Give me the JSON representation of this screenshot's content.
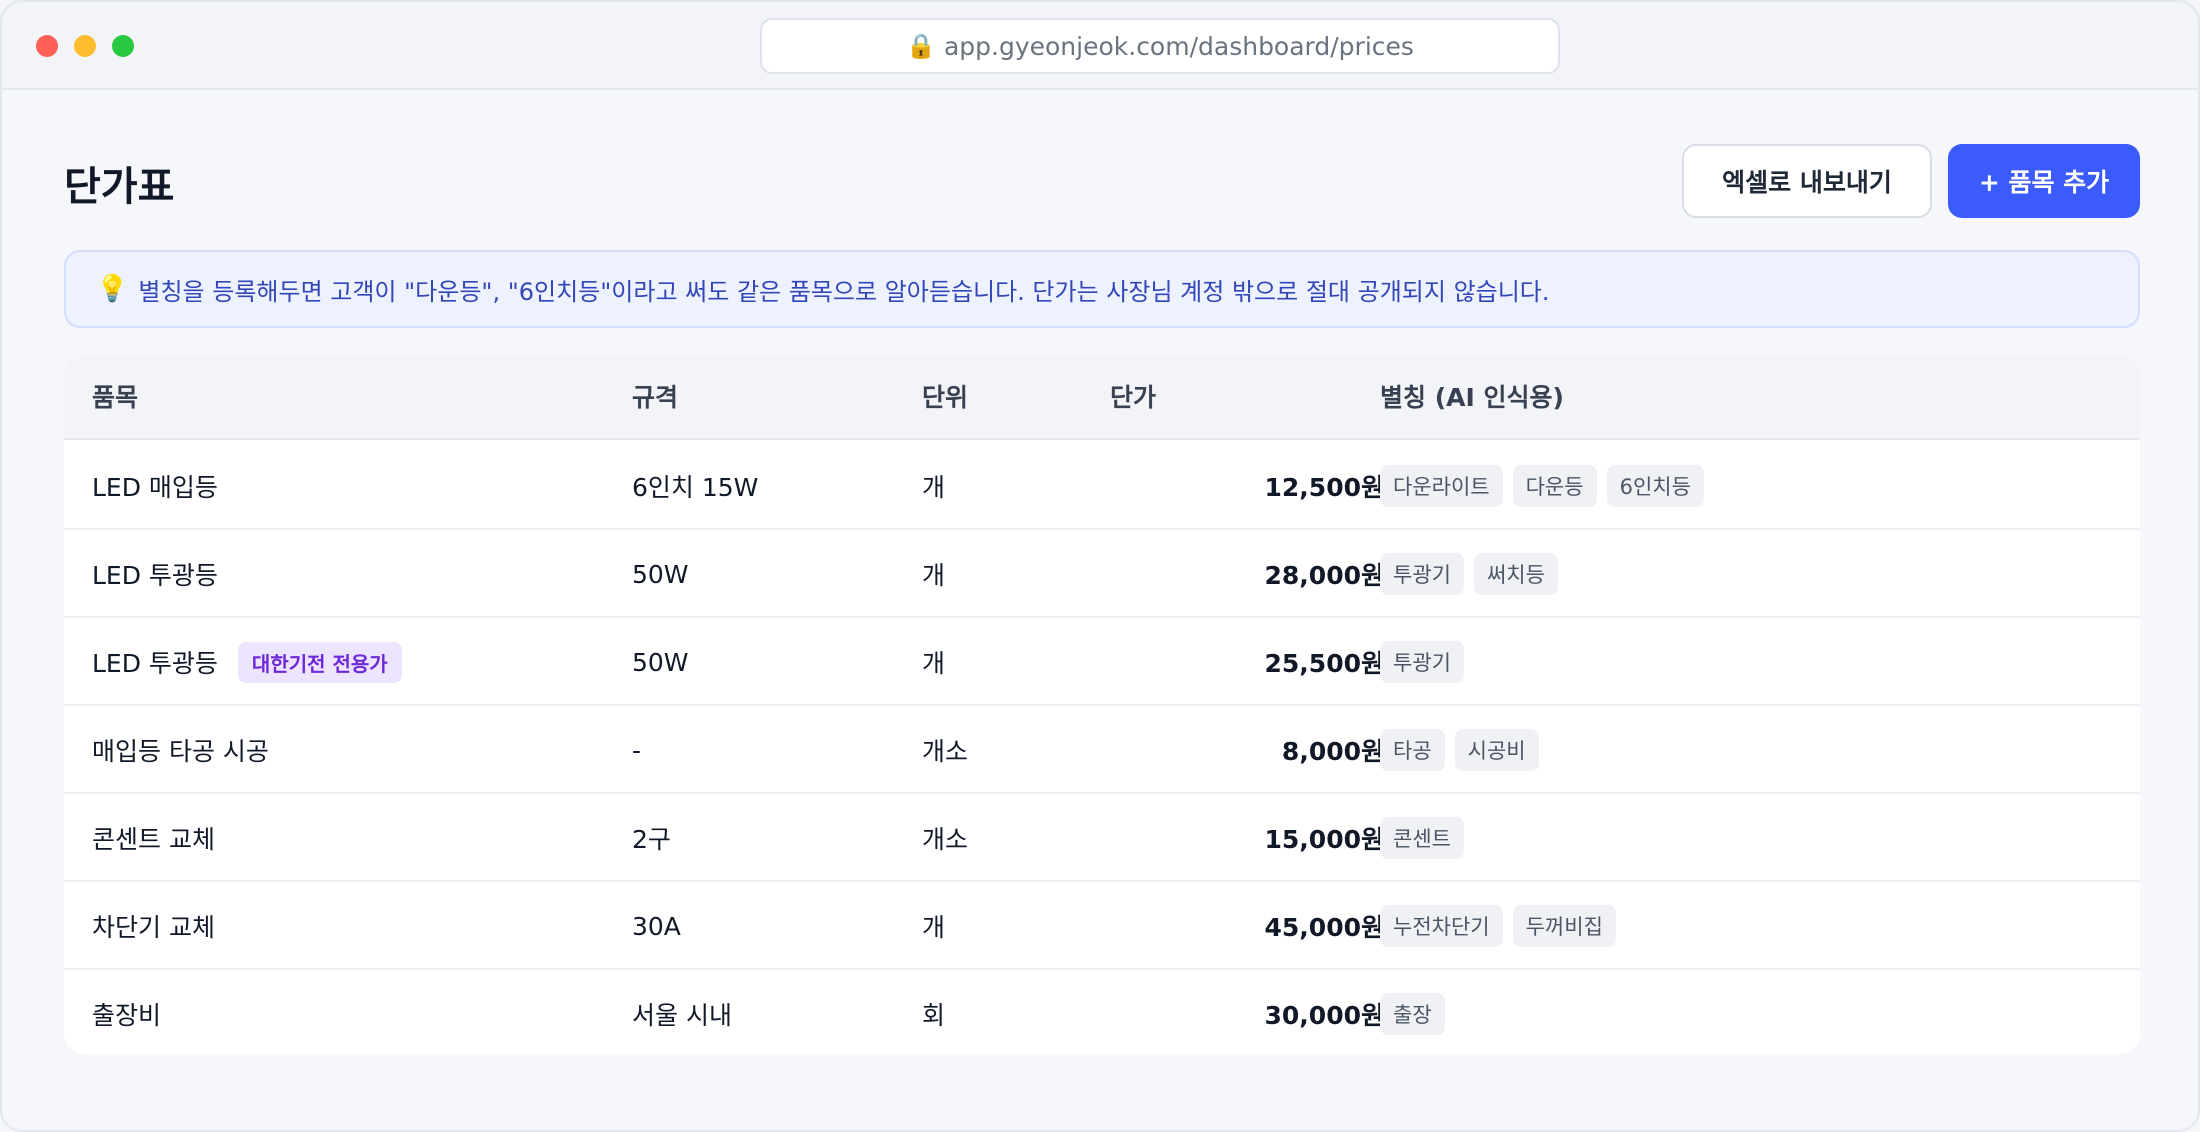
{
  "browser": {
    "url": "app.gyeonjeok.com/dashboard/prices",
    "lock_icon": "🔒"
  },
  "page": {
    "title": "단가표",
    "export_button": "엑셀로 내보내기",
    "add_button": "+ 품목 추가"
  },
  "notice": {
    "icon": "💡",
    "text": "별칭을 등록해두면 고객이 \"다운등\", \"6인치등\"이라고 써도 같은 품목으로 알아듣습니다. 단가는 사장님 계정 밖으로 절대 공개되지 않습니다."
  },
  "table": {
    "headers": {
      "item": "품목",
      "spec": "규격",
      "unit": "단위",
      "price": "단가",
      "alias": "별칭 (AI 인식용)"
    },
    "rows": [
      {
        "item": "LED 매입등",
        "badge": "",
        "spec": "6인치 15W",
        "unit": "개",
        "price": "12,500원",
        "aliases": [
          "다운라이트",
          "다운등",
          "6인치등"
        ]
      },
      {
        "item": "LED 투광등",
        "badge": "",
        "spec": "50W",
        "unit": "개",
        "price": "28,000원",
        "aliases": [
          "투광기",
          "써치등"
        ]
      },
      {
        "item": "LED 투광등",
        "badge": "대한기전 전용가",
        "spec": "50W",
        "unit": "개",
        "price": "25,500원",
        "aliases": [
          "투광기"
        ]
      },
      {
        "item": "매입등 타공 시공",
        "badge": "",
        "spec": "-",
        "unit": "개소",
        "price": "8,000원",
        "aliases": [
          "타공",
          "시공비"
        ]
      },
      {
        "item": "콘센트 교체",
        "badge": "",
        "spec": "2구",
        "unit": "개소",
        "price": "15,000원",
        "aliases": [
          "콘센트"
        ]
      },
      {
        "item": "차단기 교체",
        "badge": "",
        "spec": "30A",
        "unit": "개",
        "price": "45,000원",
        "aliases": [
          "누전차단기",
          "두꺼비집"
        ]
      },
      {
        "item": "출장비",
        "badge": "",
        "spec": "서울 시내",
        "unit": "회",
        "price": "30,000원",
        "aliases": [
          "출장"
        ]
      }
    ]
  }
}
